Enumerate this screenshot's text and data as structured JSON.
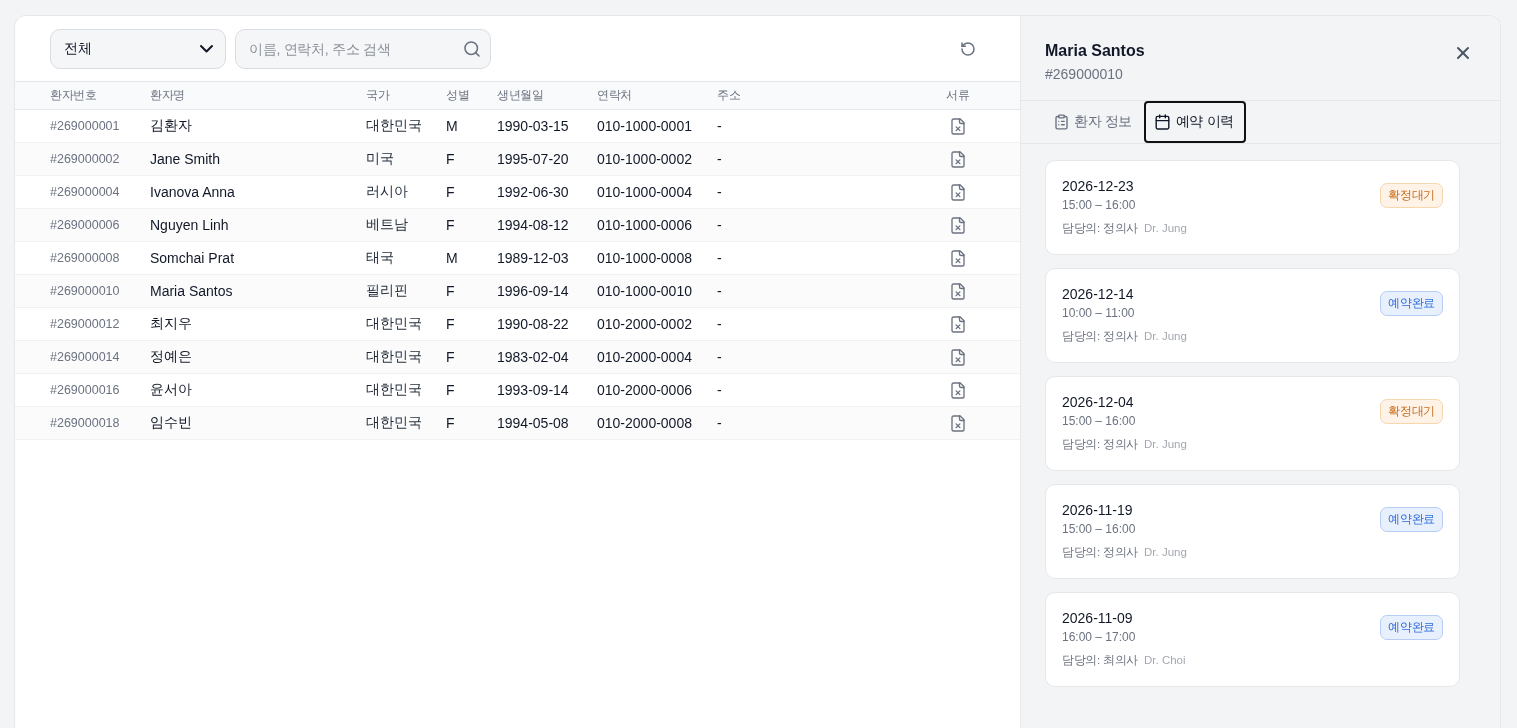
{
  "filter": {
    "value": "전체"
  },
  "search": {
    "placeholder": "이름, 연락처, 주소 검색"
  },
  "table": {
    "columns": [
      "환자번호",
      "환자명",
      "국가",
      "성별",
      "생년월일",
      "연락처",
      "주소",
      "서류"
    ],
    "rows": [
      {
        "id": "#269000001",
        "name": "김환자",
        "country": "대한민국",
        "gender": "M",
        "birth": "1990-03-15",
        "phone": "010-1000-0001",
        "address": "-"
      },
      {
        "id": "#269000002",
        "name": "Jane Smith",
        "country": "미국",
        "gender": "F",
        "birth": "1995-07-20",
        "phone": "010-1000-0002",
        "address": "-"
      },
      {
        "id": "#269000004",
        "name": "Ivanova Anna",
        "country": "러시아",
        "gender": "F",
        "birth": "1992-06-30",
        "phone": "010-1000-0004",
        "address": "-"
      },
      {
        "id": "#269000006",
        "name": "Nguyen Linh",
        "country": "베트남",
        "gender": "F",
        "birth": "1994-08-12",
        "phone": "010-1000-0006",
        "address": "-"
      },
      {
        "id": "#269000008",
        "name": "Somchai Prat",
        "country": "태국",
        "gender": "M",
        "birth": "1989-12-03",
        "phone": "010-1000-0008",
        "address": "-"
      },
      {
        "id": "#269000010",
        "name": "Maria Santos",
        "country": "필리핀",
        "gender": "F",
        "birth": "1996-09-14",
        "phone": "010-1000-0010",
        "address": "-"
      },
      {
        "id": "#269000012",
        "name": "최지우",
        "country": "대한민국",
        "gender": "F",
        "birth": "1990-08-22",
        "phone": "010-2000-0002",
        "address": "-"
      },
      {
        "id": "#269000014",
        "name": "정예은",
        "country": "대한민국",
        "gender": "F",
        "birth": "1983-02-04",
        "phone": "010-2000-0004",
        "address": "-"
      },
      {
        "id": "#269000016",
        "name": "윤서아",
        "country": "대한민국",
        "gender": "F",
        "birth": "1993-09-14",
        "phone": "010-2000-0006",
        "address": "-"
      },
      {
        "id": "#269000018",
        "name": "임수빈",
        "country": "대한민국",
        "gender": "F",
        "birth": "1994-05-08",
        "phone": "010-2000-0008",
        "address": "-"
      }
    ]
  },
  "detail": {
    "name": "Maria Santos",
    "id": "#269000010",
    "tabs": [
      {
        "label": "환자 정보",
        "kind": "info",
        "selected": false
      },
      {
        "label": "예약 이력",
        "kind": "history",
        "selected": true
      }
    ],
    "appointments": [
      {
        "date": "2026-12-23",
        "time": "15:00 – 16:00",
        "doctor_label": "담당의: 정의사",
        "doctor_name": "Dr. Jung",
        "status": {
          "label": "확정대기",
          "kind": "pending"
        }
      },
      {
        "date": "2026-12-14",
        "time": "10:00 – 11:00",
        "doctor_label": "담당의: 정의사",
        "doctor_name": "Dr. Jung",
        "status": {
          "label": "예약완료",
          "kind": "booked"
        }
      },
      {
        "date": "2026-12-04",
        "time": "15:00 – 16:00",
        "doctor_label": "담당의: 정의사",
        "doctor_name": "Dr. Jung",
        "status": {
          "label": "확정대기",
          "kind": "pending"
        }
      },
      {
        "date": "2026-11-19",
        "time": "15:00 – 16:00",
        "doctor_label": "담당의: 정의사",
        "doctor_name": "Dr. Jung",
        "status": {
          "label": "예약완료",
          "kind": "booked"
        }
      },
      {
        "date": "2026-11-09",
        "time": "16:00 – 17:00",
        "doctor_label": "담당의: 최의사",
        "doctor_name": "Dr. Choi",
        "status": {
          "label": "예약완료",
          "kind": "booked"
        }
      }
    ]
  }
}
